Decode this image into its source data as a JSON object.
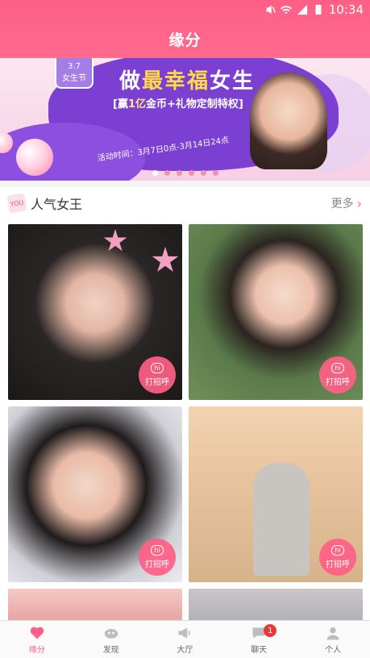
{
  "status_bar": {
    "time": "10:34"
  },
  "header": {
    "title": "缘分"
  },
  "banner": {
    "badge_line1": "3.7",
    "badge_line2": "女生节",
    "headline_part1": "做",
    "headline_highlight": "最幸福",
    "headline_part2": "女生",
    "sub_open": "[赢",
    "sub_highlight": "1亿",
    "sub_rest": "金币+礼物定制特权]",
    "time_text": "活动时间：3月7日0点-3月14日24点",
    "dots": 6,
    "active_dot": 0
  },
  "section": {
    "icon_text": "YOU",
    "title": "人气女王",
    "more_label": "更多",
    "more_chevron": "›"
  },
  "cards": [
    {
      "greet_small": "hi",
      "greet_label": "打招呼"
    },
    {
      "greet_small": "hi",
      "greet_label": "打招呼"
    },
    {
      "greet_small": "hi",
      "greet_label": "打招呼"
    },
    {
      "greet_small": "hi",
      "greet_label": "打招呼"
    }
  ],
  "nav": {
    "items": [
      {
        "label": "缘分",
        "icon": "heart-icon"
      },
      {
        "label": "发现",
        "icon": "discover-icon"
      },
      {
        "label": "大厅",
        "icon": "megaphone-icon"
      },
      {
        "label": "聊天",
        "icon": "chat-icon"
      },
      {
        "label": "个人",
        "icon": "person-icon"
      }
    ],
    "chat_badge": "1"
  },
  "colors": {
    "primary": "#ff5f86",
    "banner_purple": "#7b3fd1",
    "highlight_yellow": "#ffd84a",
    "badge_red": "#e53935"
  }
}
